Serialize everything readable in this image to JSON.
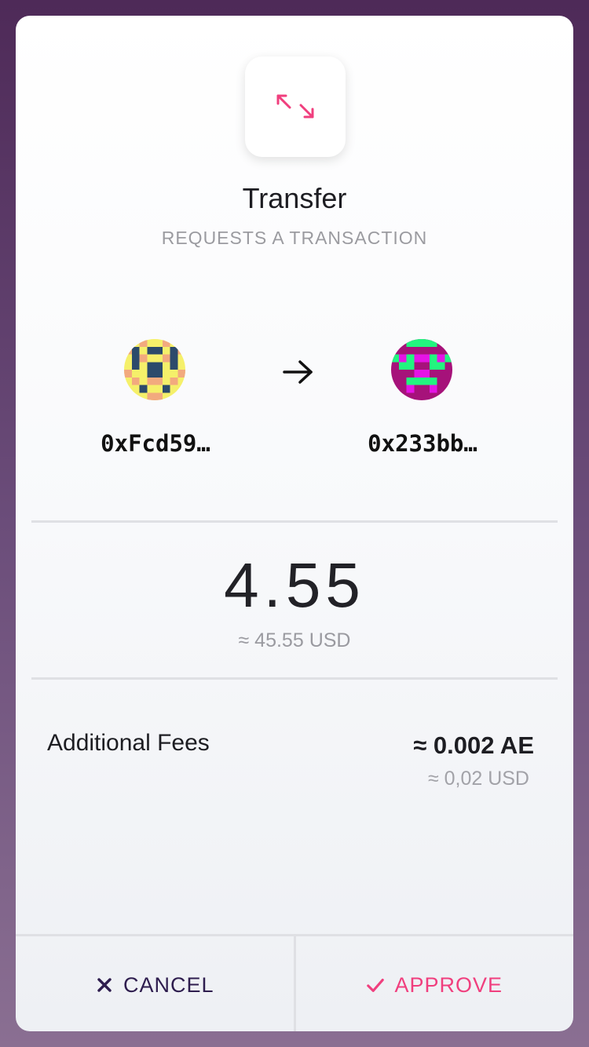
{
  "request": {
    "title": "Transfer",
    "subtitle": "REQUESTS A TRANSACTION",
    "icon": "transfer-arrows-icon"
  },
  "transfer": {
    "from_address": "0xFcd59…",
    "to_address": "0x233bb…",
    "arrow_icon": "arrow-right-icon"
  },
  "amount": {
    "value": "4.55",
    "usd": "≈ 45.55 USD"
  },
  "fees": {
    "label": "Additional Fees",
    "value": "≈ 0.002 AE",
    "usd": "≈ 0,02 USD"
  },
  "actions": {
    "cancel_label": "CANCEL",
    "approve_label": "APPROVE"
  },
  "colors": {
    "accent": "#f03f7e",
    "cancel": "#2e1d4e",
    "from_avatar_primary": "#f5f06a",
    "from_avatar_secondary": "#f2aa7e",
    "from_avatar_dark": "#2c4a6b",
    "to_avatar_primary": "#a6127a",
    "to_avatar_secondary": "#22f57f",
    "to_avatar_accent": "#e514e6"
  }
}
